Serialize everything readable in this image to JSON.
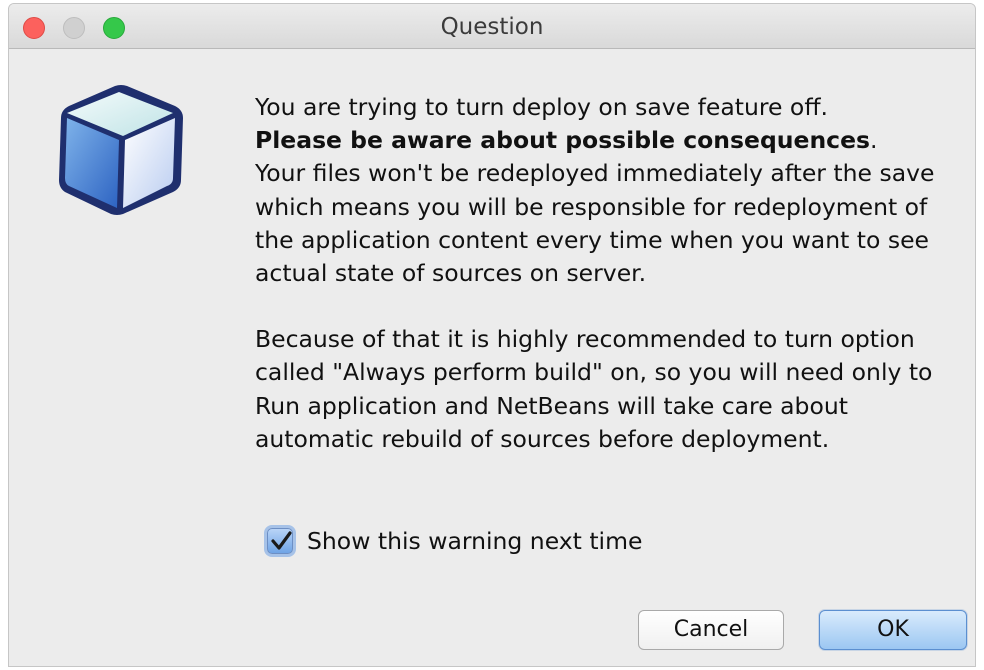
{
  "window": {
    "title": "Question"
  },
  "message": {
    "line1": "You are trying to turn deploy on save feature off.",
    "bold_line": "Please be aware about possible consequences",
    "bold_suffix": ".",
    "para1_rest": "Your files won't be redeployed immediately after the save which means you will be responsible for redeployment of the application content every time when you want to see actual state of sources on server.",
    "para2": "Because of that it is highly recommended to turn option called \"Always perform build\" on, so you will need only to Run application and NetBeans will take care about automatic rebuild of sources before deployment."
  },
  "checkbox": {
    "label": "Show this warning next time",
    "checked": true
  },
  "buttons": {
    "cancel_label": "Cancel",
    "ok_label": "OK"
  },
  "icons": {
    "app_icon": "netbeans-cube-icon",
    "check_icon": "checkmark-icon"
  },
  "colors": {
    "close": "#fc615d",
    "zoom": "#35c84a",
    "accent": "#6fa4e6"
  }
}
